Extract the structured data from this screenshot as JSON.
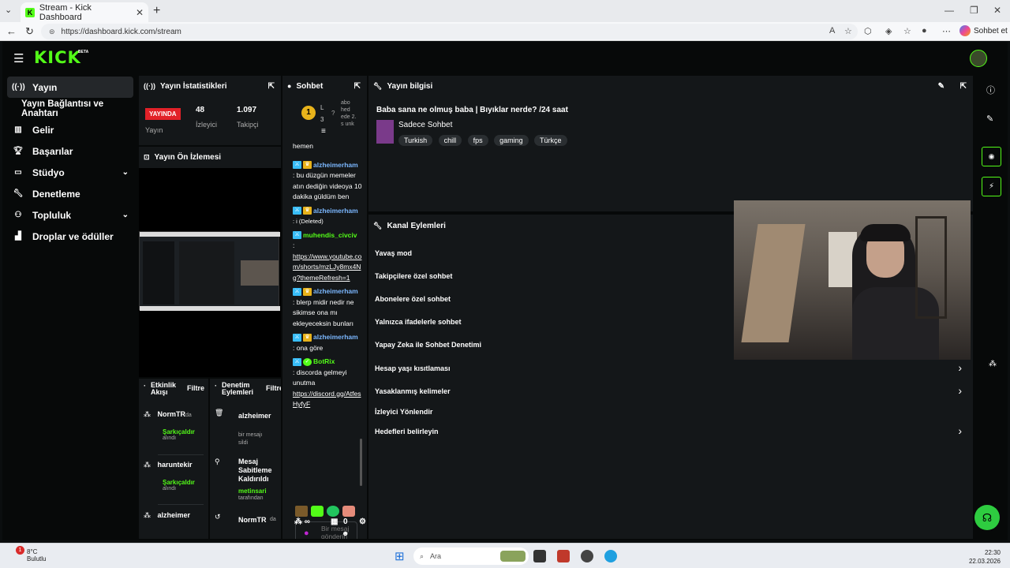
{
  "browser": {
    "tab_title": "Stream - Kick Dashboard",
    "url": "https://dashboard.kick.com/stream",
    "copilot_label": "Sohbet et"
  },
  "app": {
    "logo": "KICK",
    "beta": "BETA"
  },
  "sidebar": {
    "items": [
      {
        "label": "Yayın",
        "icon": "broadcast-icon"
      },
      {
        "label": "Yayın Bağlantısı ve Anahtarı",
        "icon": ""
      },
      {
        "label": "Gelir",
        "icon": "chart-icon"
      },
      {
        "label": "Başarılar",
        "icon": "trophy-icon"
      },
      {
        "label": "Stüdyo",
        "icon": "studio-icon"
      },
      {
        "label": "Denetleme",
        "icon": "wrench-icon"
      },
      {
        "label": "Topluluk",
        "icon": "people-icon"
      },
      {
        "label": "Droplar ve ödüller",
        "icon": "gift-icon"
      }
    ]
  },
  "stats": {
    "title": "Yayın İstatistikleri",
    "status": "YAYINDA",
    "status_label": "Yayın",
    "viewers": "48",
    "viewers_label": "İzleyici",
    "followers": "1.097",
    "followers_label": "Takipçi"
  },
  "preview": {
    "title": "Yayın Ön İzlemesi"
  },
  "activity": {
    "title": "Etkinlik Akışı",
    "filter": "Filtre",
    "rows": [
      {
        "user": "NormTR",
        "suffix": "da",
        "action": "Şarkıçaldır",
        "sub": "alındı"
      },
      {
        "user": "haruntekir",
        "suffix": "",
        "action": "Şarkıçaldır",
        "sub": "alındı"
      },
      {
        "user": "alzheimer",
        "suffix": "",
        "action": "",
        "sub": ""
      }
    ]
  },
  "moderation": {
    "title": "Denetim Eylemleri",
    "filter": "Filtre",
    "rows": [
      {
        "title": "alzheimer",
        "line1": "bir mesajı",
        "line2": "sildi"
      },
      {
        "title": "Mesaj Sabitleme Kaldırıldı",
        "line1": "metinsari",
        "line2": "tarafından"
      },
      {
        "title": "NormTR",
        "suffix": "da",
        "line1": "",
        "line2": ""
      }
    ]
  },
  "chat": {
    "title": "Sohbet",
    "pinned_level": "1",
    "pinned_text": "abo hed ede 2. s unk",
    "pinned_l": "L",
    "pinned_num": "3",
    "first_line": "hemen",
    "messages": [
      {
        "user": "alzheimerham",
        "text": ": bu düzgün memeler atın dediğin videoya 10 dakika güldüm ben"
      },
      {
        "user": "alzheimerham",
        "text": ": i (Deleted)"
      },
      {
        "user": "muhendis_civciv",
        "text": ":",
        "link": "https://www.youtube.com/shorts/mzLJy8mx4Ng?themeRefresh=1"
      },
      {
        "user": "alzheimerham",
        "text": ": blerp midir nedir ne sikimse ona mı ekleyeceksin bunları"
      },
      {
        "user": "alzheimerham",
        "text": ": ona göre"
      },
      {
        "user": "BotRix",
        "text": ": discorda gelmeyi unutma",
        "link": "https://discord.gg/AtfesHyfyF"
      }
    ],
    "input_placeholder": "Bir mesaj gönderin",
    "footer_infinity": "∞",
    "footer_count": "0"
  },
  "info": {
    "title": "Yayın bilgisi",
    "stream_title": "Baba sana ne olmuş baba | Bıyıklar nerde? /24 saat",
    "category": "Sadece Sohbet",
    "tags": [
      "Turkish",
      "chill",
      "fps",
      "gaming",
      "Türkçe"
    ]
  },
  "actions": {
    "title": "Kanal Eylemleri",
    "items": [
      {
        "label": "Yavaş mod",
        "arrow": false
      },
      {
        "label": "Takipçilere özel sohbet",
        "arrow": false
      },
      {
        "label": "Abonelere özel sohbet",
        "arrow": false
      },
      {
        "label": "Yalnızca ifadelerle sohbet",
        "arrow": false
      },
      {
        "label": "Yapay Zeka ile Sohbet Denetimi",
        "arrow": false
      },
      {
        "label": "Hesap yaşı kısıtlaması",
        "arrow": true
      },
      {
        "label": "Yasaklanmış kelimeler",
        "arrow": true
      },
      {
        "label": "İzleyici Yönlendir",
        "arrow": false
      },
      {
        "label": "Hedefleri belirleyin",
        "arrow": true
      }
    ]
  },
  "taskbar": {
    "weather_temp": "8°C",
    "weather_desc": "Bulutlu",
    "weather_badge": "1",
    "search_placeholder": "Ara",
    "time": "22:30",
    "date": "22.03.2026"
  },
  "colors": {
    "accent": "#53fc18",
    "live": "#e22128",
    "panel": "#141719"
  }
}
